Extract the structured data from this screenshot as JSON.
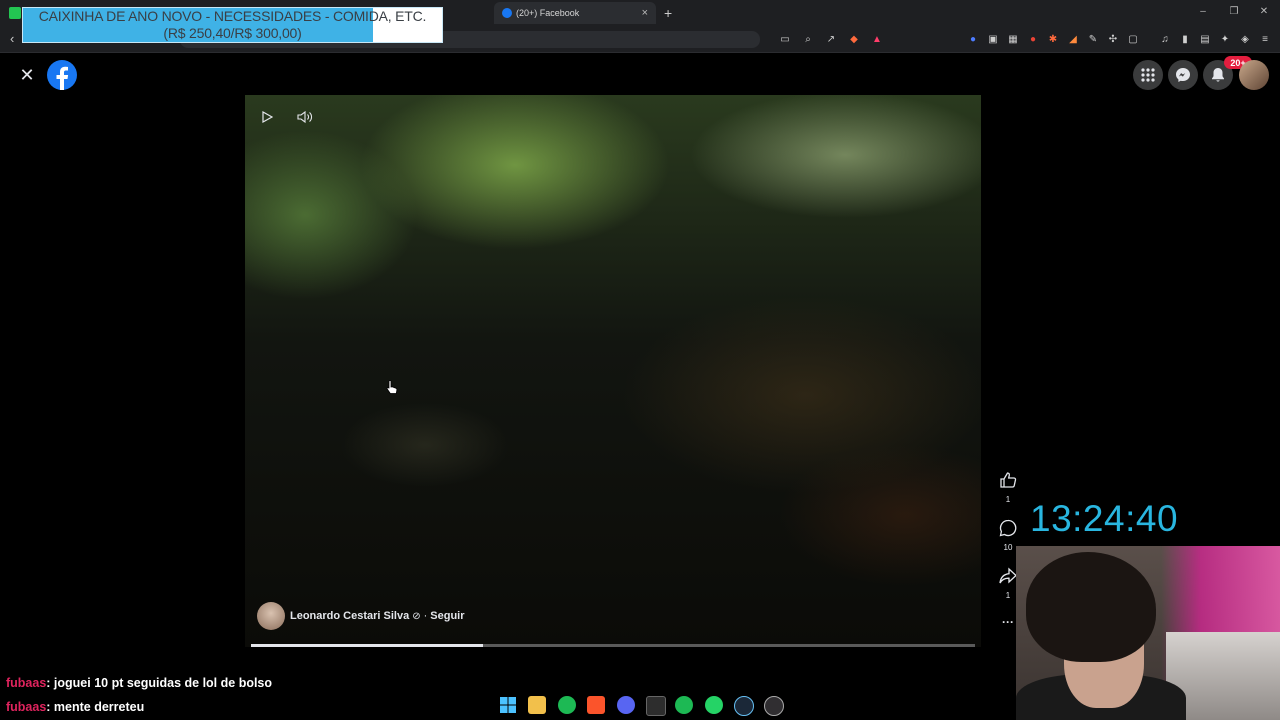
{
  "browser": {
    "tab_title": "(20+) Facebook",
    "new_tab": "+",
    "tab_close": "×"
  },
  "donation": {
    "line1": "CAIXINHA DE ANO NOVO - NECESSIDADES - COMIDA, ETC.",
    "line2": "(R$ 250,40/R$ 300,00)",
    "raised": 250.4,
    "goal": 300.0
  },
  "facebook": {
    "close": "✕",
    "notifications_badge": "20+"
  },
  "video": {
    "author": "Leonardo Cestari Silva",
    "follow": "Seguir",
    "separator": "·",
    "progress": 0.32
  },
  "actions": {
    "likes": "1",
    "comments": "10",
    "shares": "1",
    "more": "···"
  },
  "stream": {
    "clock": "13:24:40",
    "chat": [
      {
        "user": "fubaas",
        "message": ": joguei 10 pt seguidas de lol de bolso"
      },
      {
        "user": "fubaas",
        "message": ": mente derreteu"
      }
    ]
  },
  "colors": {
    "facebook_blue": "#1877f2",
    "clock_cyan": "#29b6e0",
    "chat_user": "#e0245e",
    "donation_bar": "#3fb2e6"
  },
  "icons": [
    "close-icon",
    "facebook-logo",
    "grid-icon",
    "messenger-icon",
    "bell-icon",
    "play-icon",
    "volume-icon",
    "like-icon",
    "comment-icon",
    "share-icon",
    "more-icon"
  ]
}
